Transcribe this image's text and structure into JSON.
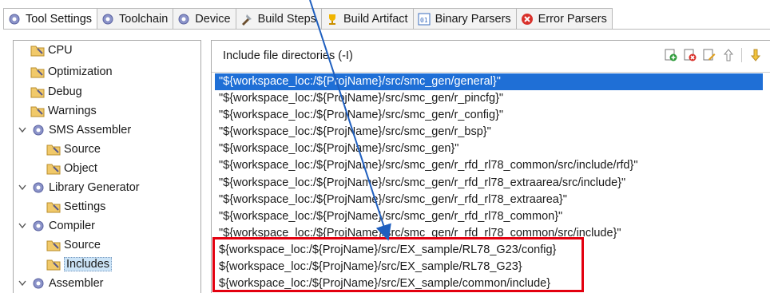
{
  "tabs": [
    {
      "label": "Tool Settings",
      "icon": "gear-icon",
      "active": true
    },
    {
      "label": "Toolchain",
      "icon": "gear-icon"
    },
    {
      "label": "Device",
      "icon": "gear-icon"
    },
    {
      "label": "Build Steps",
      "icon": "build-steps-icon"
    },
    {
      "label": "Build Artifact",
      "icon": "trophy-icon"
    },
    {
      "label": "Binary Parsers",
      "icon": "binary-icon"
    },
    {
      "label": "Error Parsers",
      "icon": "error-icon"
    }
  ],
  "tree": [
    {
      "label": "CPU"
    },
    {
      "label": "Optimization"
    },
    {
      "label": "Debug"
    },
    {
      "label": "Warnings"
    },
    {
      "label": "SMS Assembler"
    },
    {
      "label": "Source"
    },
    {
      "label": "Object"
    },
    {
      "label": "Library Generator"
    },
    {
      "label": "Settings"
    },
    {
      "label": "Compiler"
    },
    {
      "label": "Source"
    },
    {
      "label": "Includes"
    },
    {
      "label": "Assembler"
    }
  ],
  "panel": {
    "title": "Include file directories (-I)",
    "entries": [
      "\"${workspace_loc:/${ProjName}/src/smc_gen/general}\"",
      "\"${workspace_loc:/${ProjName}/src/smc_gen/r_pincfg}\"",
      "\"${workspace_loc:/${ProjName}/src/smc_gen/r_config}\"",
      "\"${workspace_loc:/${ProjName}/src/smc_gen/r_bsp}\"",
      "\"${workspace_loc:/${ProjName}/src/smc_gen}\"",
      "\"${workspace_loc:/${ProjName}/src/smc_gen/r_rfd_rl78_common/src/include/rfd}\"",
      "\"${workspace_loc:/${ProjName}/src/smc_gen/r_rfd_rl78_extraarea/src/include}\"",
      "\"${workspace_loc:/${ProjName}/src/smc_gen/r_rfd_rl78_extraarea}\"",
      "\"${workspace_loc:/${ProjName}/src/smc_gen/r_rfd_rl78_common}\"",
      "\"${workspace_loc:/${ProjName}/src/smc_gen/r_rfd_rl78_common/src/include}\"",
      "${workspace_loc:/${ProjName}/src/EX_sample/RL78_G23/config}",
      "${workspace_loc:/${ProjName}/src/EX_sample/RL78_G23}",
      "${workspace_loc:/${ProjName}/src/EX_sample/common/include}"
    ]
  },
  "colors": {
    "selection": "#1f6fd6",
    "highlight_box": "#e3000f",
    "arrow": "#1f5fbf"
  }
}
